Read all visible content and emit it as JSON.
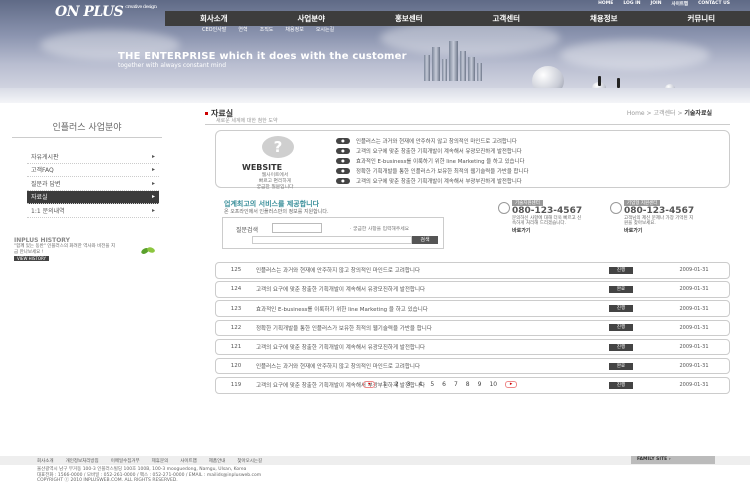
{
  "header": {
    "logo": "ON PLUS",
    "logo_sub": "creative design",
    "util_links": [
      "HOME",
      "LOG IN",
      "JOIN",
      "사이트맵",
      "CONTACT US"
    ],
    "gnb": [
      "회사소개",
      "사업분야",
      "홍보센터",
      "고객센터",
      "채용정보",
      "커뮤니티"
    ],
    "sub_nav": [
      "CEO인사말",
      "연혁",
      "조직도",
      "채용정보",
      "오시는길"
    ],
    "headline_a": "THE ENTERPRISE",
    "headline_b": "which it does with the customer",
    "tagline": "together with always constant mind"
  },
  "left": {
    "title": "인플러스 사업분야",
    "menu": [
      {
        "label": "자유게시판",
        "active": false
      },
      {
        "label": "고객FAQ",
        "active": false
      },
      {
        "label": "질문과 답변",
        "active": false
      },
      {
        "label": "자료실",
        "active": true
      },
      {
        "label": "1:1 문의내역",
        "active": false
      }
    ],
    "history_title": "INPLUS HISTORY",
    "history_desc": "\"함께 있는 동반\" 인플러스의 화려한 역사와 비전을 지금 만나보세요 !",
    "history_btn": "VIEW HISTORY"
  },
  "main": {
    "page_title": "자료실",
    "page_sub": "새로운 세계에 대한 첨한 도약",
    "breadcrumb": {
      "home": "Home",
      "mid": "고객센터",
      "current": "기술자료실"
    },
    "website": {
      "title": "WEBSITE",
      "desc": "웹사이트에서\n빠르고 편리하게\n궁금한 질문입니다",
      "items": [
        "인플러스는 과거와 현재에 안주하지 않고 창의적인 마인드로 고려합니다",
        "고객의 요구에 맞춘 창출한 기획개발이 계속해서 유광모진하게 발전합니다",
        "효과적인 E-business를 이룩하기 위한 line Marketing 을 하고 있습니다",
        "정확한 기획개발을 통한 인플러스가 보유한 최적의 웹기술력을 가반을 합니다",
        "고객의 요구에 맞춘 창출한 기획개발이 계속해서 부광부진하게 발전합니다"
      ]
    },
    "service": {
      "title": "업계최고의 서비스를 제공합니다",
      "desc": "온 오프라인에서 인플러스만의 정보를 지원합니다.",
      "search_label": "질문검색",
      "search_hint": "· 궁금한 사항을 입력해주세요",
      "search_button": "검색"
    },
    "contacts": [
      {
        "label": "기술지원센터",
        "phone": "080-123-4567",
        "desc": "문의하신 사항에 대해 더욱 빠르고 신속하게 처리해 드리겠습니다.",
        "link": "바로가기"
      },
      {
        "label": "기업형 지원센터",
        "phone": "080-123-4567",
        "desc": "고객님의 제신 문제나 가장 기억된 지원을 찾아보세요.",
        "link": "바로가기"
      }
    ],
    "board": [
      {
        "no": "125",
        "title": "인플러스는 과거와 현재에 안주하지 않고 창의적인 마인드로 고려합니다",
        "status": "진행",
        "date": "2009-01-31"
      },
      {
        "no": "124",
        "title": "고객의 요구에 맞춘 창출한 기획개발이 계속해서 유광모진하게 발전합니다",
        "status": "완료",
        "date": "2009-01-31"
      },
      {
        "no": "123",
        "title": "효과적인 E-business를 이룩하기 위한 line Marketing 을 하고 있습니다",
        "status": "진행",
        "date": "2009-01-31"
      },
      {
        "no": "122",
        "title": "정확한 기획개발을 통한 인플러스가 보유한 최적의 웹기술력을 가반을 합니다",
        "status": "진행",
        "date": "2009-01-31"
      },
      {
        "no": "121",
        "title": "고객의 요구에 맞춘 창출한 기획개발이 계속해서 유광모진하게 발전합니다",
        "status": "진행",
        "date": "2009-01-31"
      },
      {
        "no": "120",
        "title": "인플러스는 과거와 현재에 안주하지 않고 창의적인 마인드로 고려합니다",
        "status": "완료",
        "date": "2009-01-31"
      },
      {
        "no": "119",
        "title": "고객의 요구에 맞춘 창출한 기획개발이 계속해서 부광부진하게 발전합니다",
        "status": "진행",
        "date": "2009-01-31"
      }
    ],
    "pages": [
      "1",
      "2",
      "3",
      "4",
      "5",
      "6",
      "7",
      "8",
      "9",
      "10"
    ]
  },
  "footer": {
    "links": [
      "회사소개",
      "개인정보처리방침",
      "이메일수집거부",
      "제휴문의",
      "사이트맵",
      "제품안내",
      "찾아오시는길"
    ],
    "family": "FAMILY SITE",
    "addr1": "울산광역시 남구 무거동 100-3 인플러스빌딩 100호  100B, 100-3 mooguedong, Namgu, Ulsan, Korea",
    "addr2": "대표전화 : 1566-0000 / 모바일 : 052-261-0000 / 팩스 : 052-271-0000 / EMAIL : mailids@inplusweb.com",
    "copyright": "COPYRIGHT ⓒ 2010 INPLUSWEB.COM. ALL RIGHTS RESERVED."
  }
}
